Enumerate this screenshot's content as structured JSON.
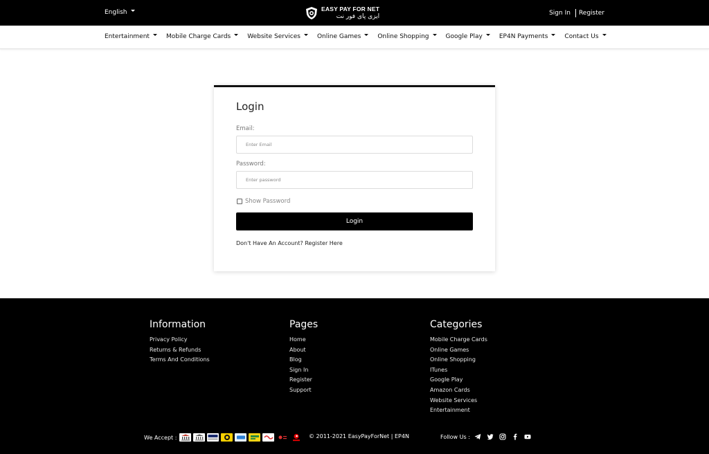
{
  "topbar": {
    "language": "English",
    "logo": {
      "en": "EASY PAY FOR NET",
      "ar": "ایزی پای فور نت"
    },
    "sign_in": "Sign In",
    "register": "Register"
  },
  "nav": {
    "items": [
      "Entertainment",
      "Mobile Charge Cards",
      "Website Services",
      "Online Games",
      "Online Shopping",
      "Google Play",
      "EP4N Payments",
      "Contact Us"
    ]
  },
  "login": {
    "title": "Login",
    "email_label": "Email:",
    "email_placeholder": "Enter Email",
    "email_value": "",
    "password_label": "Password:",
    "password_placeholder": "Enter password",
    "password_value": "",
    "show_password": "Show Password",
    "show_password_checked": false,
    "submit": "Login",
    "no_account": "Don't Have An Account?",
    "register_here": "Register Here"
  },
  "footer": {
    "information": {
      "title": "Information",
      "links": [
        "Privacy Policy",
        "Returns & Refunds",
        "Terms And Conditions"
      ]
    },
    "pages": {
      "title": "Pages",
      "links": [
        "Home",
        "About",
        "Blog",
        "Sign In",
        "Register",
        "Support"
      ]
    },
    "categories": {
      "title": "Categories",
      "links": [
        "Mobile Charge Cards",
        "Online Games",
        "Online Shopping",
        "ITunes",
        "Google Play",
        "Amazon Cards",
        "Website Services",
        "Entertainment"
      ]
    },
    "we_accept": "We Accept :",
    "payment_icons": [
      "bank-icon",
      "bank-icon",
      "ebank-transfer-icon",
      "yellow-wallet-icon",
      "blue-card-icon",
      "yellow-pay-icon",
      "red-pay-icon",
      "mobile-pay-icon",
      "vodafone-icon"
    ],
    "copyright": "© 2011-2021 EasyPayForNet | EP4N",
    "follow_us": "Follow Us :",
    "social_icons": [
      "telegram-icon",
      "twitter-icon",
      "instagram-icon",
      "facebook-icon",
      "youtube-icon"
    ]
  },
  "colors": {
    "topbar_bg": "#000000",
    "footer_bg": "#000000",
    "button_bg": "#000000",
    "page_bg": "#ffffff"
  }
}
